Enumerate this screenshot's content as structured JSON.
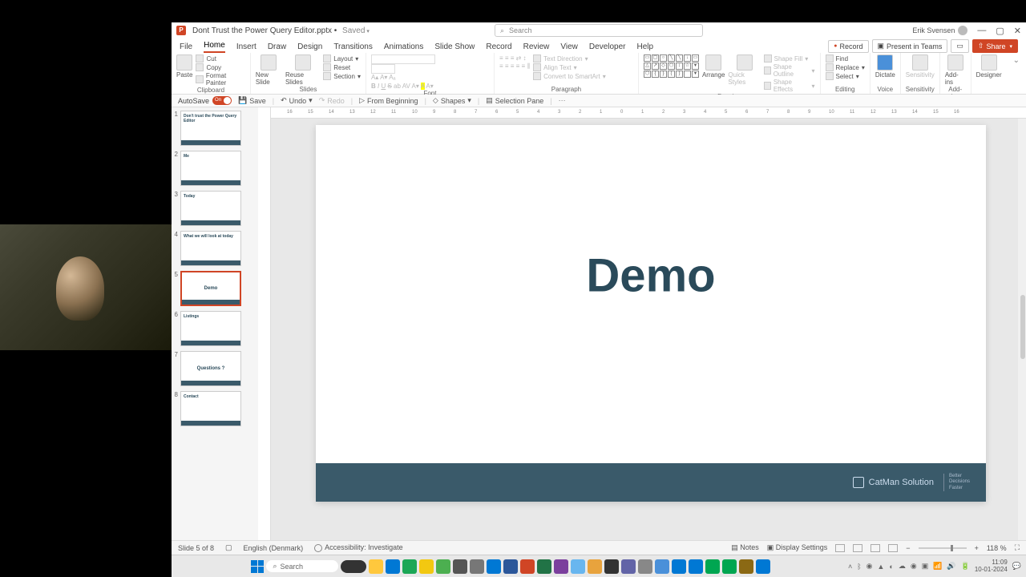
{
  "titlebar": {
    "doc_name": "Dont Trust the Power Query Editor.pptx",
    "saved_state": "Saved",
    "search_placeholder": "Search",
    "user_name": "Erik Svensen",
    "min": "—",
    "max": "▢",
    "close": "✕"
  },
  "menu": {
    "tabs": [
      "File",
      "Home",
      "Insert",
      "Draw",
      "Design",
      "Transitions",
      "Animations",
      "Slide Show",
      "Record",
      "Review",
      "View",
      "Developer",
      "Help"
    ],
    "active": "Home",
    "record_btn": "Record",
    "present_btn": "Present in Teams",
    "share_btn": "Share"
  },
  "ribbon": {
    "clipboard": {
      "label": "Clipboard",
      "paste": "Paste",
      "cut": "Cut",
      "copy": "Copy",
      "format": "Format Painter"
    },
    "slides": {
      "label": "Slides",
      "new": "New Slide",
      "reuse": "Reuse Slides",
      "layout": "Layout",
      "reset": "Reset",
      "section": "Section"
    },
    "font": {
      "label": "Font"
    },
    "paragraph": {
      "label": "Paragraph",
      "text_dir": "Text Direction",
      "align": "Align Text",
      "convert": "Convert to SmartArt"
    },
    "drawing": {
      "label": "Drawing",
      "arrange": "Arrange",
      "quick": "Quick Styles",
      "fill": "Shape Fill",
      "outline": "Shape Outline",
      "effects": "Shape Effects"
    },
    "editing": {
      "label": "Editing",
      "find": "Find",
      "replace": "Replace",
      "select": "Select"
    },
    "voice": {
      "label": "Voice",
      "dictate": "Dictate"
    },
    "sensitivity": {
      "label": "Sensitivity",
      "btn": "Sensitivity"
    },
    "addins": {
      "label": "Add-ins",
      "btn": "Add-ins"
    },
    "designer": {
      "label": "",
      "btn": "Designer"
    }
  },
  "qat": {
    "autosave": "AutoSave",
    "on": "On",
    "save": "Save",
    "undo": "Undo",
    "redo": "Redo",
    "from_begin": "From Beginning",
    "shapes": "Shapes",
    "selection": "Selection Pane"
  },
  "thumbs": [
    {
      "n": "1",
      "title": "Don't trust the Power Query Editor"
    },
    {
      "n": "2",
      "title": "Me"
    },
    {
      "n": "3",
      "title": "Today"
    },
    {
      "n": "4",
      "title": "What we will look at today"
    },
    {
      "n": "5",
      "title": "Demo",
      "selected": true
    },
    {
      "n": "6",
      "title": "Listings"
    },
    {
      "n": "7",
      "title": "Questions ?"
    },
    {
      "n": "8",
      "title": "Contact"
    }
  ],
  "slide": {
    "title": "Demo",
    "brand": "CatMan Solution",
    "tag1": "Better",
    "tag2": "Decisions",
    "tag3": "Faster"
  },
  "hruler_ticks": [
    "16",
    "15",
    "14",
    "13",
    "12",
    "11",
    "10",
    "9",
    "8",
    "7",
    "6",
    "5",
    "4",
    "3",
    "2",
    "1",
    "0",
    "1",
    "2",
    "3",
    "4",
    "5",
    "6",
    "7",
    "8",
    "9",
    "10",
    "11",
    "12",
    "13",
    "14",
    "15",
    "16"
  ],
  "status": {
    "slide": "Slide 5 of 8",
    "lang": "English (Denmark)",
    "access": "Accessibility: Investigate",
    "notes": "Notes",
    "display": "Display Settings",
    "zoom": "118 %"
  },
  "taskbar": {
    "search": "Search",
    "time": "11:09",
    "date": "10-01-2024"
  }
}
